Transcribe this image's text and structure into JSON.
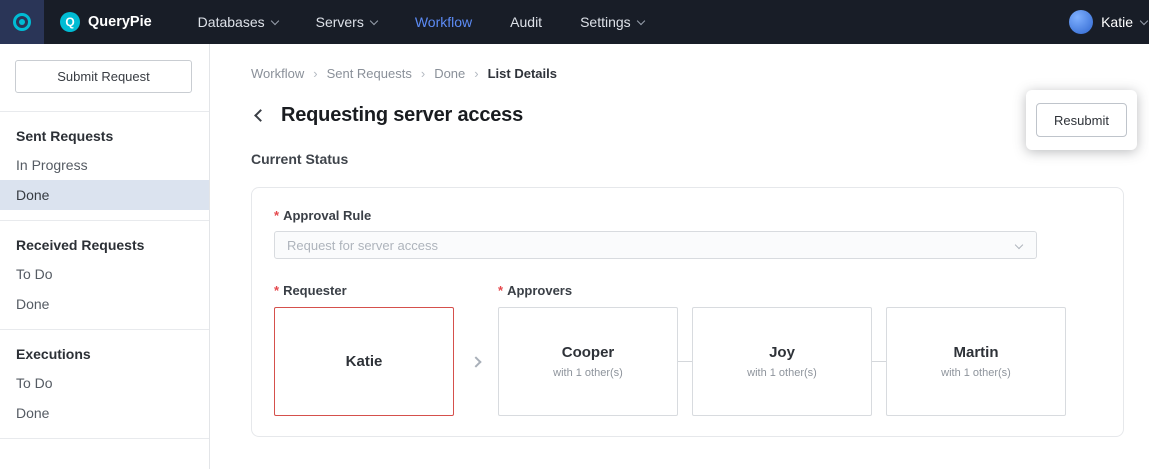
{
  "navbar": {
    "brand": "QueryPie",
    "brand_initial": "Q",
    "items": [
      {
        "label": "Databases",
        "dropdown": true,
        "active": false
      },
      {
        "label": "Servers",
        "dropdown": true,
        "active": false
      },
      {
        "label": "Workflow",
        "dropdown": false,
        "active": true
      },
      {
        "label": "Audit",
        "dropdown": false,
        "active": false
      },
      {
        "label": "Settings",
        "dropdown": true,
        "active": false
      }
    ],
    "user": {
      "name": "Katie"
    }
  },
  "sidebar": {
    "submit_button": "Submit Request",
    "sections": [
      {
        "title": "Sent Requests",
        "items": [
          {
            "label": "In Progress",
            "active": false
          },
          {
            "label": "Done",
            "active": true
          }
        ]
      },
      {
        "title": "Received Requests",
        "items": [
          {
            "label": "To Do",
            "active": false
          },
          {
            "label": "Done",
            "active": false
          }
        ]
      },
      {
        "title": "Executions",
        "items": [
          {
            "label": "To Do",
            "active": false
          },
          {
            "label": "Done",
            "active": false
          }
        ]
      }
    ]
  },
  "main": {
    "breadcrumb": [
      "Workflow",
      "Sent Requests",
      "Done",
      "List Details"
    ],
    "breadcrumb_separator": "›",
    "title": "Requesting server access",
    "resubmit_label": "Resubmit",
    "section_label": "Current Status",
    "form": {
      "required_marker": "*",
      "approval_rule_label": "Approval Rule",
      "approval_rule_placeholder": "Request for server access",
      "requester_label": "Requester",
      "approvers_label": "Approvers",
      "requester": {
        "name": "Katie"
      },
      "approvers": [
        {
          "name": "Cooper",
          "subtitle": "with 1 other(s)"
        },
        {
          "name": "Joy",
          "subtitle": "with 1 other(s)"
        },
        {
          "name": "Martin",
          "subtitle": "with 1 other(s)"
        }
      ]
    }
  },
  "colors": {
    "navbar_bg": "#181D27",
    "accent_blue": "#5C8BF5",
    "brand_teal": "#00BCD4",
    "requester_border": "#D5504C",
    "active_item_bg": "#DBE3EF"
  }
}
